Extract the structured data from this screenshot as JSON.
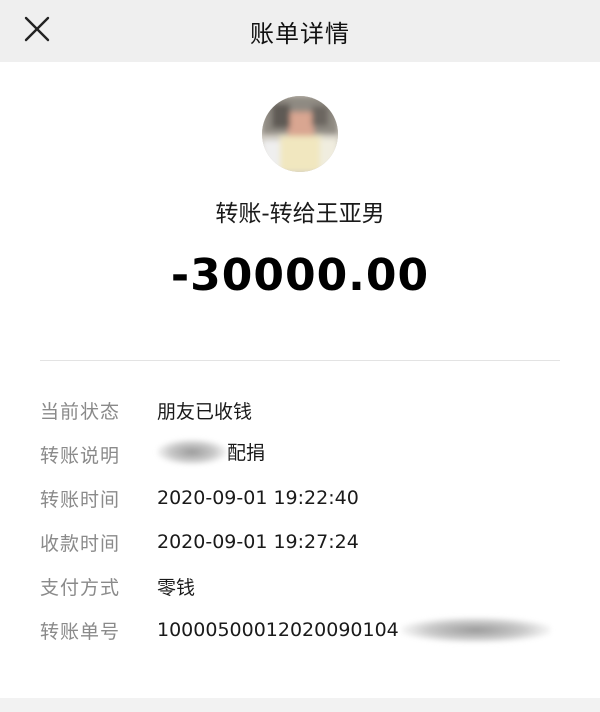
{
  "header": {
    "title": "账单详情",
    "close_icon": "close-icon"
  },
  "summary": {
    "avatar_icon": "blurred-avatar",
    "title": "转账-转给王亚男",
    "amount": "-30000.00"
  },
  "details": [
    {
      "label": "当前状态",
      "value": "朋友已收钱"
    },
    {
      "label": "转账说明",
      "value": "配捐",
      "redacted_prefix": true
    },
    {
      "label": "转账时间",
      "value": "2020-09-01 19:22:40"
    },
    {
      "label": "收款时间",
      "value": "2020-09-01 19:27:24"
    },
    {
      "label": "支付方式",
      "value": "零钱"
    },
    {
      "label": "转账单号",
      "value": "10000500012020090104",
      "redacted_suffix": true
    }
  ],
  "colors": {
    "header_bg": "#efefef",
    "label": "#8a8a8a",
    "text": "#1a1a1a"
  }
}
